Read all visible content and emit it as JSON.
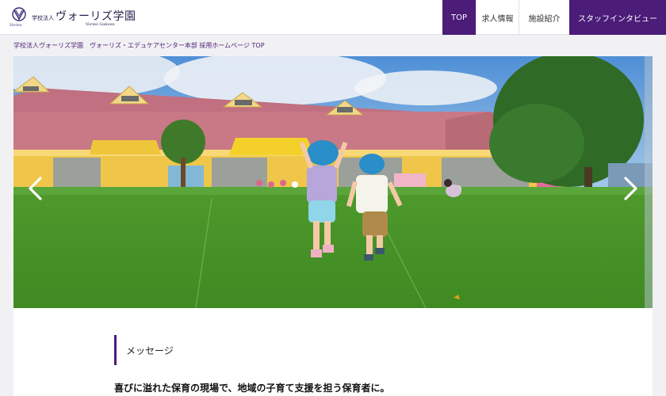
{
  "header": {
    "logo": {
      "corporate_type": "学校法人",
      "name": "ヴォーリズ学園",
      "roman_name": "Vories Gakuen",
      "mark_caption": "Vories"
    },
    "nav": [
      {
        "label": "TOP",
        "active": true
      },
      {
        "label": "求人情報",
        "active": false
      },
      {
        "label": "施設紹介",
        "active": false
      },
      {
        "label": "スタッフインタビュー",
        "active": false
      }
    ]
  },
  "breadcrumb": "学校法人ヴォーリズ学園　ヴォーリズ・エデュケアセンター本部 採用ホームページ TOP",
  "hero": {
    "prev_icon": "chevron-left-icon",
    "next_icon": "chevron-right-icon"
  },
  "message": {
    "heading": "メッセージ",
    "lead": "喜びに溢れた保育の現場で、地域の子育て支援を担う保育者に。"
  },
  "colors": {
    "brand_purple": "#4b1c78",
    "page_bg": "#f1f1f3"
  }
}
